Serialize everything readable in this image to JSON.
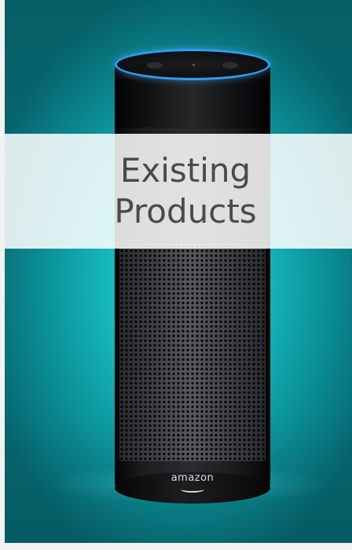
{
  "card": {
    "title": "Existing Products",
    "background_color": "#16b9bf"
  },
  "product": {
    "brand": "amazon",
    "light_ring_color": "#2f9dff"
  },
  "icons": {
    "brand_logo": "amazon-smile-logo-icon"
  }
}
